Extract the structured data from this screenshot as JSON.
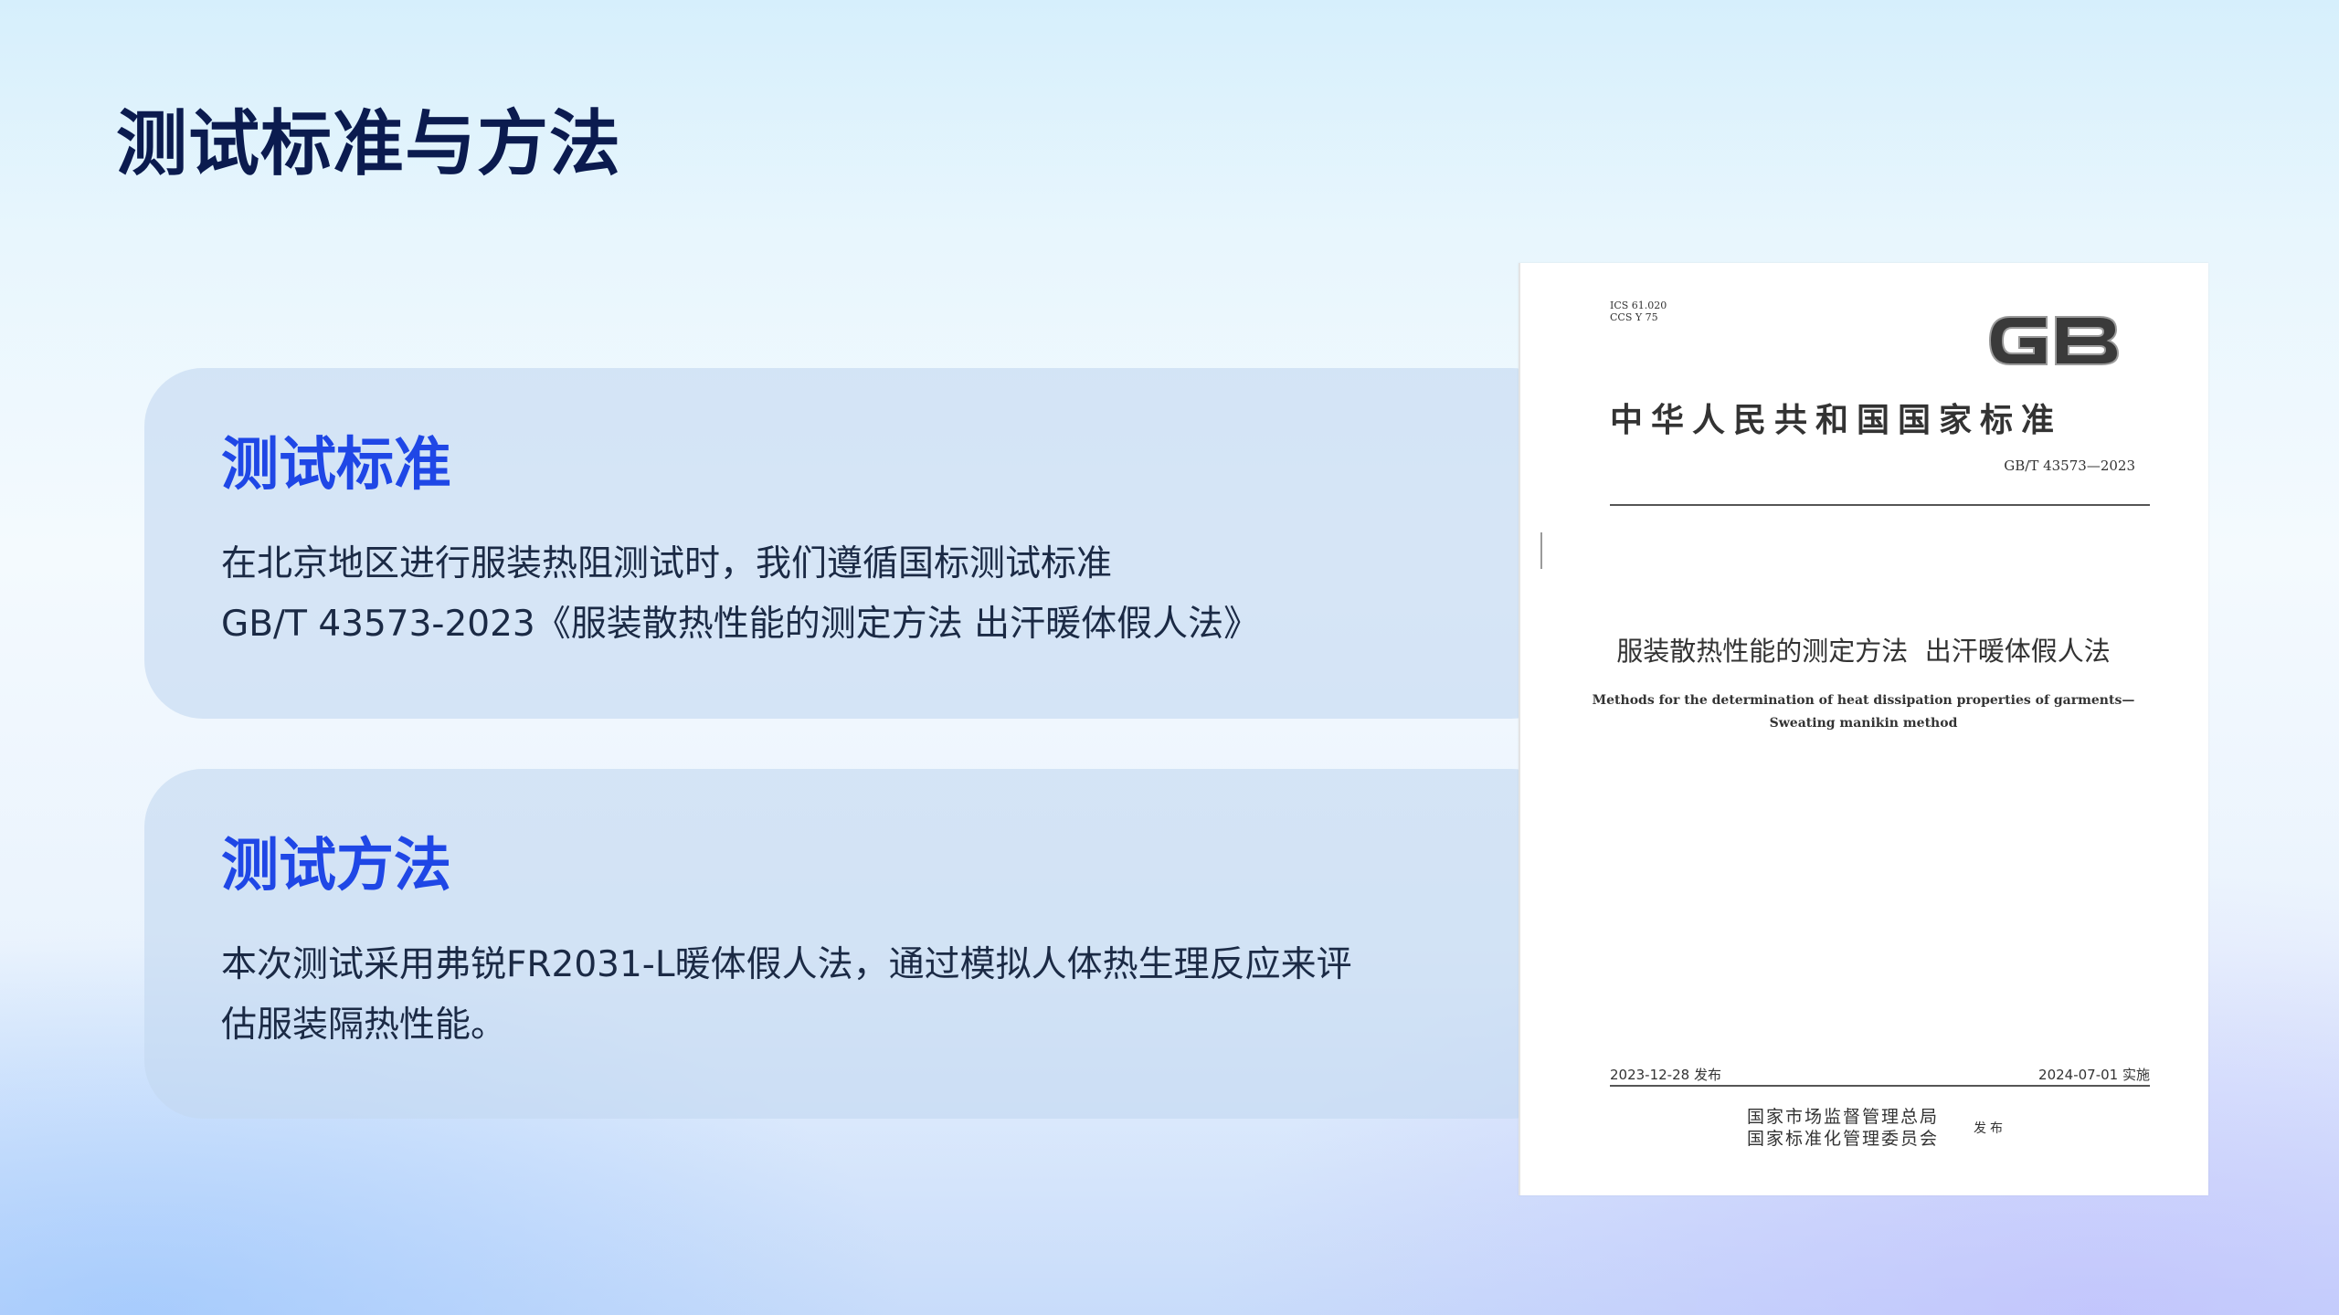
{
  "page": {
    "title": "测试标准与方法"
  },
  "standard_card": {
    "heading": "测试标准",
    "lines": [
      "在北京地区进行服装热阻测试时，我们遵循国标测试标准",
      "GB/T 43573-2023《服装散热性能的测定方法 出汗暖体假人法》"
    ]
  },
  "method_card": {
    "heading": "测试方法",
    "lines": [
      "本次测试采用弗锐FR2031-L暖体假人法，通过模拟人体热生理反应来评",
      "估服装隔热性能。"
    ]
  },
  "document": {
    "ics": "ICS 61.020",
    "ccs": "CCS Y 75",
    "logo_text": "GB",
    "national_title": "中华人民共和国国家标准",
    "standard_number": "GB/T 43573—2023",
    "cn_title": "服装散热性能的测定方法  出汗暖体假人法",
    "en_title_lines": [
      "Methods for the determination of heat dissipation properties of garments—",
      "Sweating manikin method"
    ],
    "issue_date": "2023-12-28 发布",
    "implement_date": "2024-07-01 实施",
    "publishers": [
      "国家市场监督管理总局",
      "国家标准化管理委员会"
    ],
    "publish_word": "发布"
  }
}
